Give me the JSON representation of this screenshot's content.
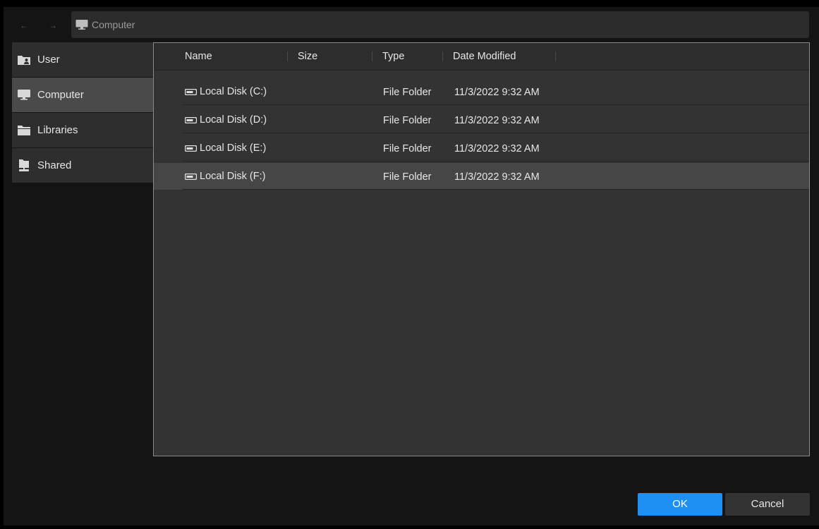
{
  "nav": {
    "back_icon": "arrow-left-icon",
    "forward_icon": "arrow-right-icon",
    "back_glyph": "←",
    "forward_glyph": "→"
  },
  "address": {
    "icon": "computer-icon",
    "text": "Computer"
  },
  "sidebar": {
    "items": [
      {
        "label": "User",
        "icon": "user-folder-icon",
        "selected": false
      },
      {
        "label": "Computer",
        "icon": "computer-icon",
        "selected": true
      },
      {
        "label": "Libraries",
        "icon": "folder-icon",
        "selected": false
      },
      {
        "label": "Shared",
        "icon": "shared-folder-icon",
        "selected": false
      }
    ]
  },
  "table": {
    "columns": [
      "Name",
      "Size",
      "Type",
      "Date Modified"
    ],
    "rows": [
      {
        "name": "Local Disk (C:)",
        "size": "",
        "type": "File Folder",
        "date": "11/3/2022 9:32 AM",
        "selected": false
      },
      {
        "name": "Local Disk (D:)",
        "size": "",
        "type": "File Folder",
        "date": "11/3/2022 9:32 AM",
        "selected": false
      },
      {
        "name": "Local Disk (E:)",
        "size": "",
        "type": "File Folder",
        "date": "11/3/2022 9:32 AM",
        "selected": false
      },
      {
        "name": "Local Disk (F:)",
        "size": "",
        "type": "File Folder",
        "date": "11/3/2022 9:32 AM",
        "selected": true
      }
    ]
  },
  "buttons": {
    "ok": "OK",
    "cancel": "Cancel"
  },
  "colors": {
    "accent": "#1e90f4",
    "selection": "#464646",
    "sidebar_selected": "#4a4a4a"
  }
}
